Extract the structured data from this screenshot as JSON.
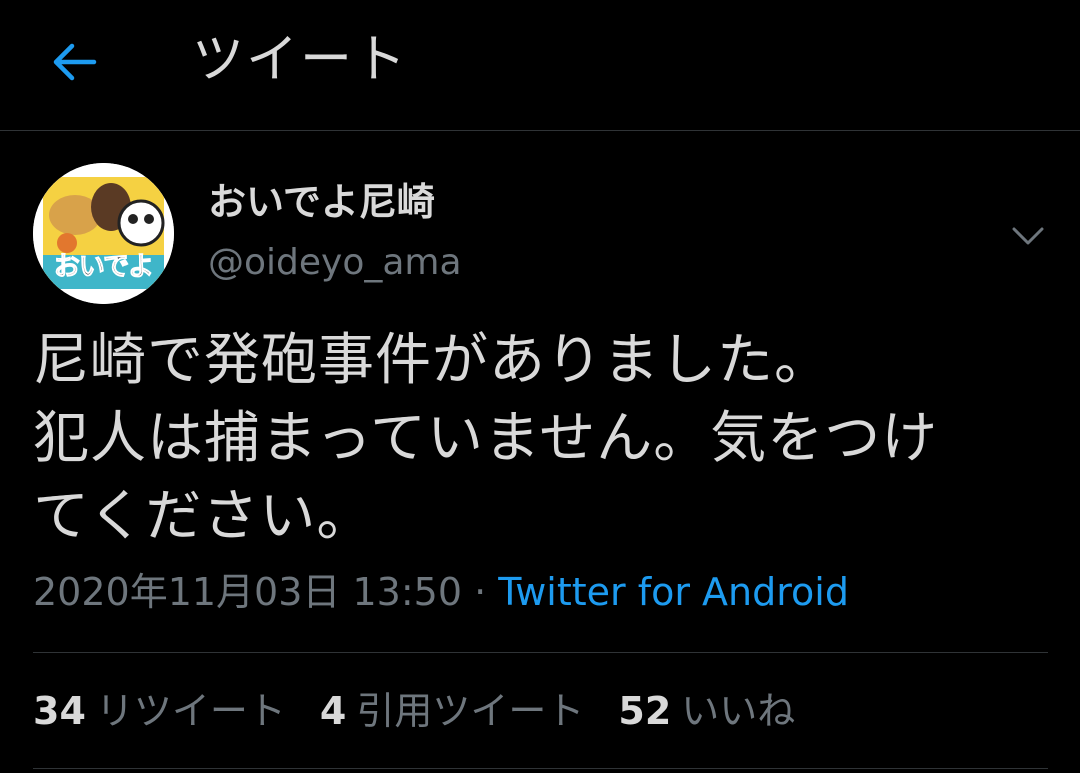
{
  "header": {
    "title": "ツイート",
    "back_icon": "arrow-left-icon"
  },
  "colors": {
    "background": "#000000",
    "accent": "#1d9bf0",
    "text_primary": "#d9d9d9",
    "text_secondary": "#6e767d",
    "divider": "#2f3336"
  },
  "tweet": {
    "author": {
      "display_name": "おいでよ尼崎",
      "handle": "@oideyo_ama",
      "avatar_text": "おいでよ"
    },
    "text": "尼崎で発砲事件がありました。\n犯人は捕まっていません。気をつけ\nてください。",
    "timestamp": "2020年11月03日 13:50",
    "separator": " · ",
    "source": "Twitter for Android",
    "more_icon": "chevron-down-icon"
  },
  "stats": {
    "retweets": {
      "count": "34",
      "label": "リツイート"
    },
    "quotes": {
      "count": "4",
      "label": "引用ツイート"
    },
    "likes": {
      "count": "52",
      "label": "いいね"
    }
  }
}
